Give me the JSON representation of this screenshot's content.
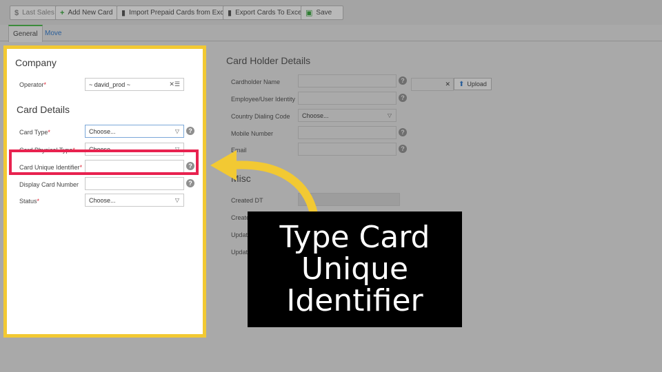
{
  "toolbar": {
    "last_sales": "Last Sales",
    "add_new_card": "Add New Card",
    "import_cards": "Import Prepaid Cards from Excel",
    "export_cards": "Export Cards To Excel",
    "save": "Save"
  },
  "tabs": {
    "general": "General",
    "move": "Move"
  },
  "company": {
    "title": "Company",
    "operator_label": "Operator",
    "operator_value": "~ david_prod ~"
  },
  "card_details": {
    "title": "Card Details",
    "card_type_label": "Card Type",
    "card_type_value": "Choose...",
    "card_physical_type_label": "Card Physical Type",
    "card_physical_type_value": "Choose...",
    "card_unique_identifier_label": "Card Unique Identifier",
    "card_unique_identifier_value": "",
    "display_card_number_label": "Display Card Number",
    "display_card_number_value": "",
    "status_label": "Status",
    "status_value": "Choose..."
  },
  "card_holder": {
    "title": "Card Holder Details",
    "cardholder_name_label": "Cardholder Name",
    "employee_identity_label": "Employee/User Identity",
    "country_code_label": "Country Dialing Code",
    "country_code_value": "Choose...",
    "mobile_label": "Mobile Number",
    "email_label": "Email",
    "upload_label": "Upload"
  },
  "misc": {
    "title": "Misc",
    "created_dt_label": "Created DT",
    "created_by_label": "Create",
    "updated_dt_label": "Update",
    "updated_by_label": "Update"
  },
  "caption": {
    "line1": "Type Card",
    "line2": "Unique",
    "line3": "Identifier"
  },
  "colors": {
    "highlight_yellow": "#f2c933",
    "highlight_red": "#e8224f",
    "tab_accent": "#3c8c3c"
  }
}
